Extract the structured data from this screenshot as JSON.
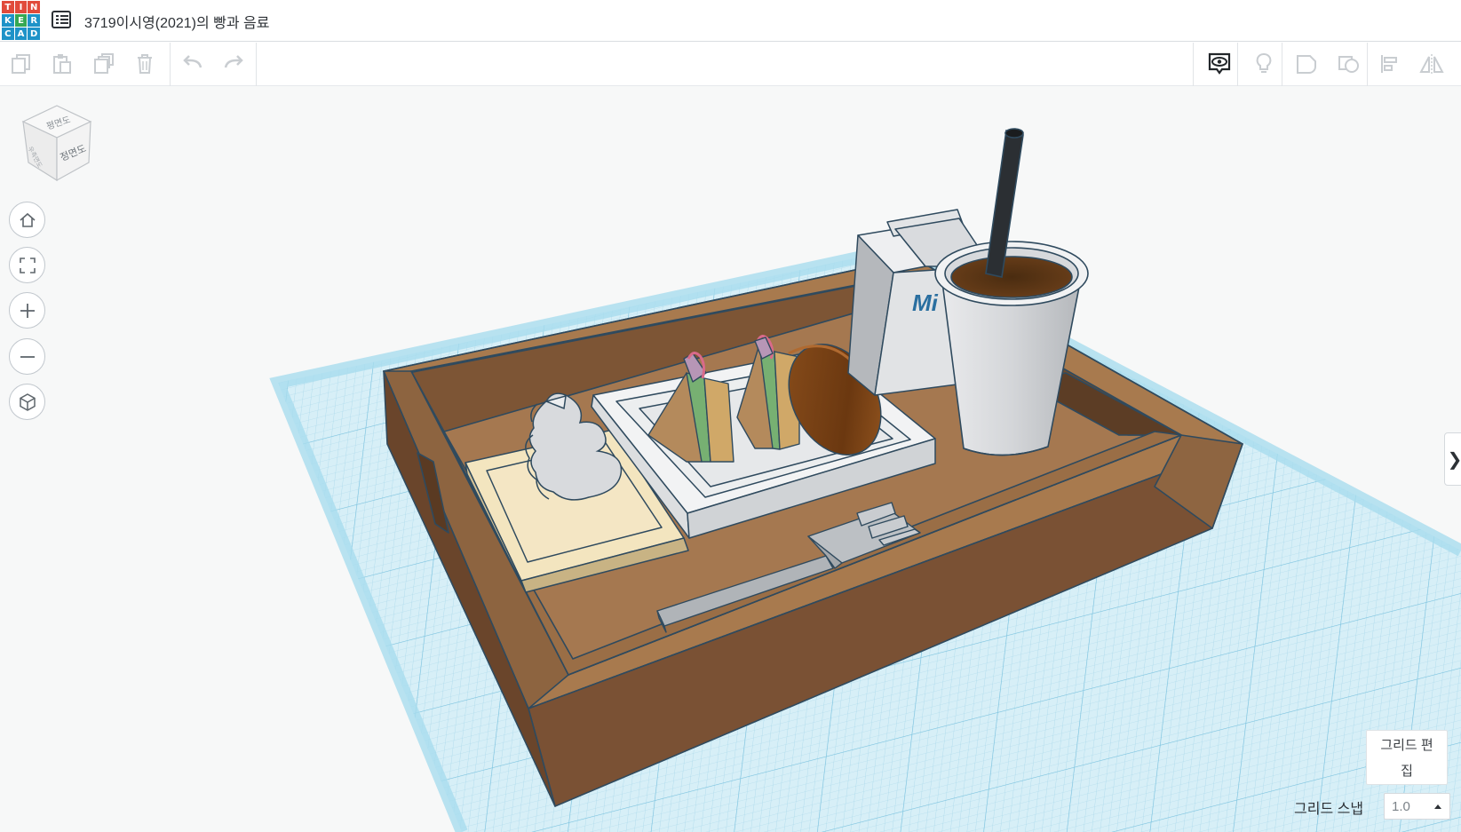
{
  "app": {
    "logo_letters": [
      "T",
      "I",
      "N",
      "K",
      "E",
      "R",
      "C",
      "A",
      "D"
    ],
    "logo_colors": [
      "#e14b3b",
      "#e14b3b",
      "#e14b3b",
      "#1e93c8",
      "#35a853",
      "#1e93c8",
      "#1e93c8",
      "#1e93c8",
      "#1e93c8"
    ]
  },
  "header": {
    "menu_icon": "list-icon",
    "design_title": "3719이시영(2021)의 빵과 음료"
  },
  "toolbar": {
    "left_icons": [
      "copy-icon",
      "paste-icon",
      "duplicate-icon",
      "delete-icon",
      "undo-icon",
      "redo-icon"
    ],
    "right_icons": [
      "show-all-icon",
      "light-bulb-icon",
      "group-icon",
      "ungroup-icon",
      "align-icon",
      "mirror-icon"
    ]
  },
  "view_cube": {
    "top_face": "평면도",
    "front_face": "정면도",
    "side_face": "우측면도"
  },
  "nav_controls": [
    "home-icon",
    "fit-view-icon",
    "zoom-in-icon",
    "zoom-out-icon",
    "perspective-icon"
  ],
  "scene": {
    "milk_label": "Mi"
  },
  "grid": {
    "edit_label_line1": "그리드 편",
    "edit_label_line2": "집",
    "snap_label": "그리드 스냅",
    "snap_value": "1.0"
  },
  "colors": {
    "tray_front": "#7a5134",
    "tray_top": "#9e7048",
    "tray_inner": "#a67a50",
    "grid_blue": "#bfe6f3",
    "outline": "#2f4a5e"
  }
}
